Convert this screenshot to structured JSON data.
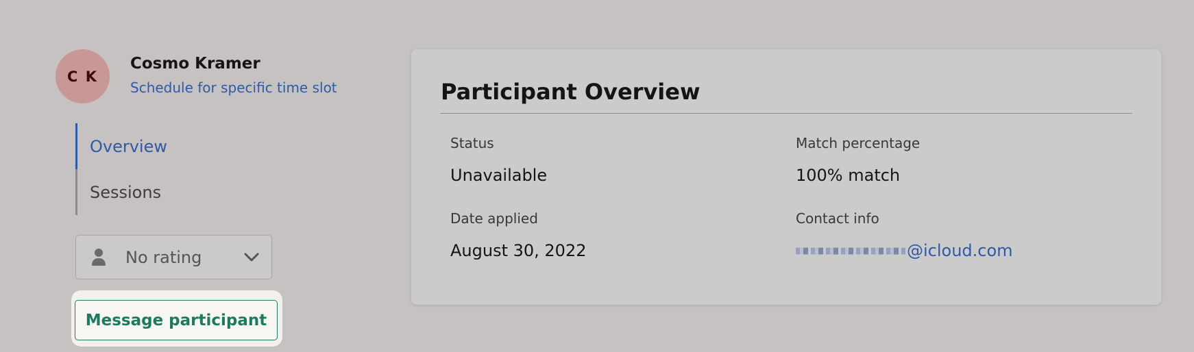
{
  "profile": {
    "initials": "C K",
    "name": "Cosmo Kramer",
    "schedule_link": "Schedule for specific time slot"
  },
  "nav": {
    "items": [
      {
        "label": "Overview",
        "active": true
      },
      {
        "label": "Sessions",
        "active": false
      }
    ]
  },
  "rating": {
    "selected": "No rating",
    "icon": "person-icon"
  },
  "actions": {
    "message_label": "Message participant"
  },
  "overview": {
    "title": "Participant Overview",
    "status_label": "Status",
    "status_value": "Unavailable",
    "match_label": "Match percentage",
    "match_value": "100% match",
    "date_label": "Date applied",
    "date_value": "August 30, 2022",
    "contact_label": "Contact info",
    "contact_value": "@icloud.com"
  },
  "colors": {
    "background": "#c6c2c1",
    "link_blue": "#2e5aa8",
    "accent_green": "#1e7a5e",
    "avatar_bg": "#c89897"
  }
}
